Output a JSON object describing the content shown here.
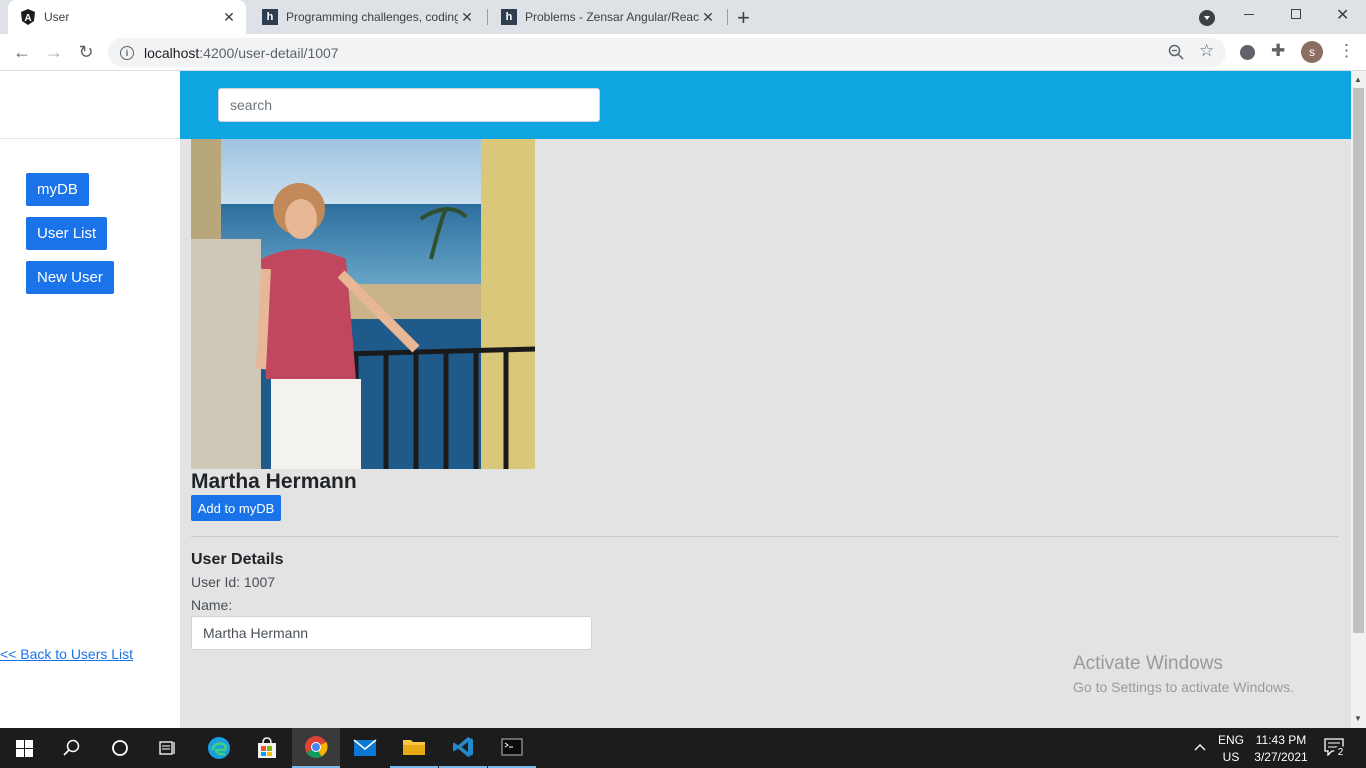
{
  "browser": {
    "tabs": [
      {
        "title": "User",
        "favicon": "angular-icon",
        "active": true
      },
      {
        "title": "Programming challenges, coding",
        "favicon": "h-icon",
        "active": false
      },
      {
        "title": "Problems - Zensar Angular/React",
        "favicon": "h-icon",
        "active": false
      }
    ],
    "new_tab": "+",
    "url_host": "localhost",
    "url_rest": ":4200/user-detail/1007",
    "profile_initial": "s"
  },
  "search": {
    "placeholder": "search"
  },
  "sidebar": {
    "items": [
      {
        "label": "myDB"
      },
      {
        "label": "User List"
      },
      {
        "label": "New User"
      }
    ]
  },
  "user": {
    "name": "Martha Hermann",
    "add_button": "Add to myDB",
    "details_title": "User Details",
    "id_label": "User Id:",
    "id_value": "1007",
    "name_label": "Name:",
    "name_value": "Martha Hermann"
  },
  "back_link": "<< Back to Users List",
  "watermark": {
    "line1": "Activate Windows",
    "line2": "Go to Settings to activate Windows."
  },
  "tray": {
    "lang1": "ENG",
    "lang2": "US",
    "time": "11:43 PM",
    "date": "3/27/2021",
    "notifications": "2"
  },
  "colors": {
    "header": "#0ea5e1",
    "button": "#1a73e8",
    "content_bg": "#e3e3e3"
  }
}
